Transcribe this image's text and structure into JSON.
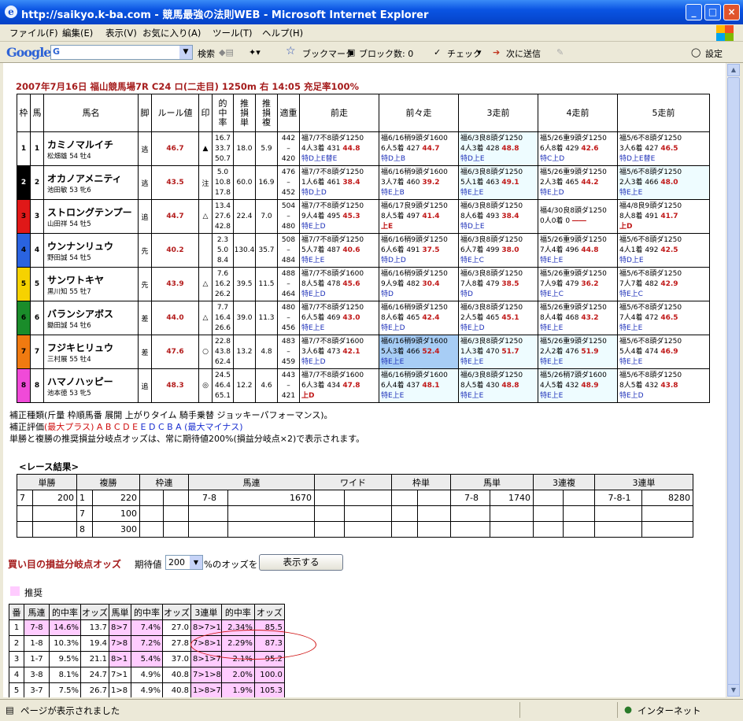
{
  "window": {
    "title": "http://saikyo.k-ba.com - 競馬最強の法則WEB - Microsoft Internet Explorer"
  },
  "menu": [
    "ファイル(F)",
    "編集(E)",
    "表示(V)",
    "お気に入り(A)",
    "ツール(T)",
    "ヘルプ(H)"
  ],
  "google_toolbar": {
    "logo": "Google",
    "search_prefix": "G",
    "search_label": "検索",
    "bookmark": "ブックマーク",
    "blocked": "ブロック数: 0",
    "check": "チェック",
    "send": "次に送信",
    "settings": "設定"
  },
  "race": {
    "title": "2007年7月16日 福山競馬場7R C24 ロ(二走目) 1250m 右 14:05 充足率100%"
  },
  "table_headers": {
    "waku": "枠",
    "uma": "馬",
    "name": "馬名",
    "kyaku": "脚",
    "rule": "ルール値",
    "shirushi": "印",
    "hit": "的中率",
    "tan": "推損単",
    "fuku": "推損複",
    "tekijyu": "適重",
    "p1": "前走",
    "p2": "前々走",
    "p3": "3走前",
    "p4": "4走前",
    "p5": "5走前"
  },
  "horses": [
    {
      "waku": "1",
      "uma": "1",
      "name": "カミノマルイチ",
      "jockey": "松畑雄 54 牡4",
      "kyaku": "逃",
      "rule": "46.7",
      "mark": "▲",
      "hit": [
        "16.7",
        "33.7",
        "50.7"
      ],
      "tan": "18.0",
      "fuku": "5.9",
      "tek": [
        "442",
        "–",
        "420"
      ],
      "past": [
        {
          "l1": "福7/7不8頭ダ1250",
          "l2a": "4人3着 431 ",
          "v": "44.8",
          "l3": "特D上E替E",
          "bg": ""
        },
        {
          "l1": "福6/16稍9頭ダ1600",
          "l2a": "6人5着 427 ",
          "v": "44.7",
          "l3": "特D上B",
          "bg": ""
        },
        {
          "l1": "福6/3良8頭ダ1250",
          "l2a": "4人3着 428 ",
          "v": "48.8",
          "l3": "特D上E",
          "bg": "cy"
        },
        {
          "l1": "福5/26重9頭ダ1250",
          "l2a": "6人8着 429 ",
          "v": "42.6",
          "l3": "特C上D",
          "bg": ""
        },
        {
          "l1": "福5/6不8頭ダ1250",
          "l2a": "3人6着 427 ",
          "v": "46.5",
          "l3": "特D上E替E",
          "bg": ""
        }
      ]
    },
    {
      "waku": "2",
      "uma": "2",
      "name": "オカノアメニティ",
      "jockey": "池田敏 53 牝6",
      "kyaku": "逃",
      "rule": "43.5",
      "mark": "注",
      "hit": [
        "5.0",
        "10.8",
        "17.8"
      ],
      "tan": "60.0",
      "fuku": "16.9",
      "tek": [
        "476",
        "–",
        "452"
      ],
      "past": [
        {
          "l1": "福7/7不8頭ダ1250",
          "l2a": "1人6着 461 ",
          "v": "38.4",
          "l3": "特D上D",
          "bg": ""
        },
        {
          "l1": "福6/16稍9頭ダ1600",
          "l2a": "3人7着 460 ",
          "v": "39.2",
          "l3": "特E上B",
          "bg": ""
        },
        {
          "l1": "福6/3良8頭ダ1250",
          "l2a": "5人1着 463 ",
          "v": "49.1",
          "l3": "特E上E",
          "bg": "cy"
        },
        {
          "l1": "福5/26重9頭ダ1250",
          "l2a": "2人3着 465 ",
          "v": "44.2",
          "l3": "特E上D",
          "bg": ""
        },
        {
          "l1": "福5/6不8頭ダ1250",
          "l2a": "2人3着 466 ",
          "v": "48.0",
          "l3": "特E上E",
          "bg": "cy"
        }
      ]
    },
    {
      "waku": "3",
      "uma": "3",
      "name": "ストロングテンプー",
      "jockey": "山田祥 54 牡5",
      "kyaku": "追",
      "rule": "44.7",
      "mark": "△",
      "hit": [
        "13.4",
        "27.6",
        "42.8"
      ],
      "tan": "22.4",
      "fuku": "7.0",
      "tek": [
        "504",
        "–",
        "480"
      ],
      "past": [
        {
          "l1": "福7/7不8頭ダ1250",
          "l2a": "9人4着 495 ",
          "v": "45.3",
          "l3": "特E上D",
          "bg": ""
        },
        {
          "l1": "福6/17良9頭ダ1250",
          "l2a": "8人5着 497 ",
          "v": "41.4",
          "l3": "上E",
          "bg": ""
        },
        {
          "l1": "福6/3良8頭ダ1250",
          "l2a": "8人6着 493 ",
          "v": "38.4",
          "l3": "特D上E",
          "bg": ""
        },
        {
          "l1": "福4/30良8頭ダ1250",
          "l2a": "0人0着 0 ",
          "v": "――",
          "l3": "",
          "bg": ""
        },
        {
          "l1": "福4/8良9頭ダ1250",
          "l2a": "8人8着 491 ",
          "v": "41.7",
          "l3": "上D",
          "bg": ""
        }
      ]
    },
    {
      "waku": "4",
      "uma": "4",
      "name": "ウンナンリュウ",
      "jockey": "野田誠 54 牡5",
      "kyaku": "先",
      "rule": "40.2",
      "mark": "",
      "hit": [
        "2.3",
        "5.0",
        "8.4"
      ],
      "tan": "130.4",
      "fuku": "35.7",
      "tek": [
        "508",
        "–",
        "484"
      ],
      "past": [
        {
          "l1": "福7/7不8頭ダ1250",
          "l2a": "5人7着 487 ",
          "v": "40.6",
          "l3": "特E上E",
          "bg": ""
        },
        {
          "l1": "福6/16稍9頭ダ1250",
          "l2a": "6人6着 491 ",
          "v": "37.5",
          "l3": "特D上D",
          "bg": ""
        },
        {
          "l1": "福6/3良8頭ダ1250",
          "l2a": "6人7着 499 ",
          "v": "38.0",
          "l3": "特E上C",
          "bg": ""
        },
        {
          "l1": "福5/26重9頭ダ1250",
          "l2a": "7人4着 496 ",
          "v": "44.8",
          "l3": "特E上E",
          "bg": ""
        },
        {
          "l1": "福5/6不8頭ダ1250",
          "l2a": "4人1着 492 ",
          "v": "42.5",
          "l3": "特D上E",
          "bg": ""
        }
      ]
    },
    {
      "waku": "5",
      "uma": "5",
      "name": "サンワトキヤ",
      "jockey": "黒川知 55 牡7",
      "kyaku": "先",
      "rule": "43.9",
      "mark": "△",
      "hit": [
        "7.6",
        "16.2",
        "26.2"
      ],
      "tan": "39.5",
      "fuku": "11.5",
      "tek": [
        "488",
        "–",
        "464"
      ],
      "past": [
        {
          "l1": "福7/7不8頭ダ1600",
          "l2a": "8人5着 478 ",
          "v": "45.6",
          "l3": "特E上D",
          "bg": ""
        },
        {
          "l1": "福6/16稍9頭ダ1250",
          "l2a": "9人9着 482 ",
          "v": "30.4",
          "l3": "特D",
          "bg": ""
        },
        {
          "l1": "福6/3良8頭ダ1250",
          "l2a": "7人8着 479 ",
          "v": "38.5",
          "l3": "特D",
          "bg": ""
        },
        {
          "l1": "福5/26重9頭ダ1250",
          "l2a": "7人9着 479 ",
          "v": "36.2",
          "l3": "特E上C",
          "bg": ""
        },
        {
          "l1": "福5/6不8頭ダ1250",
          "l2a": "7人7着 482 ",
          "v": "42.9",
          "l3": "特E上C",
          "bg": ""
        }
      ]
    },
    {
      "waku": "6",
      "uma": "6",
      "name": "バランシアボス",
      "jockey": "鋤田誠 54 牡6",
      "kyaku": "差",
      "rule": "44.0",
      "mark": "△",
      "hit": [
        "7.7",
        "16.4",
        "26.6"
      ],
      "tan": "39.0",
      "fuku": "11.3",
      "tek": [
        "480",
        "–",
        "456"
      ],
      "past": [
        {
          "l1": "福7/7不8頭ダ1250",
          "l2a": "6人5着 469 ",
          "v": "43.0",
          "l3": "特E上E",
          "bg": ""
        },
        {
          "l1": "福6/16稍9頭ダ1250",
          "l2a": "8人6着 465 ",
          "v": "42.4",
          "l3": "特E上D",
          "bg": ""
        },
        {
          "l1": "福6/3良8頭ダ1250",
          "l2a": "2人5着 465 ",
          "v": "45.1",
          "l3": "特E上D",
          "bg": ""
        },
        {
          "l1": "福5/26重9頭ダ1250",
          "l2a": "8人4着 468 ",
          "v": "43.2",
          "l3": "特E上E",
          "bg": ""
        },
        {
          "l1": "福5/6不8頭ダ1250",
          "l2a": "7人4着 472 ",
          "v": "46.5",
          "l3": "特E上E",
          "bg": ""
        }
      ]
    },
    {
      "waku": "7",
      "uma": "7",
      "name": "フジキヒリュウ",
      "jockey": "三村展 55 牡4",
      "kyaku": "差",
      "rule": "47.6",
      "mark": "○",
      "hit": [
        "22.8",
        "43.8",
        "62.4"
      ],
      "tan": "13.2",
      "fuku": "4.8",
      "tek": [
        "483",
        "–",
        "459"
      ],
      "past": [
        {
          "l1": "福7/7不8頭ダ1600",
          "l2a": "3人6着 473 ",
          "v": "42.1",
          "l3": "特E上D",
          "bg": ""
        },
        {
          "l1": "福6/16稍9頭ダ1600",
          "l2a": "5人3着 466 ",
          "v": "52.4",
          "l3": "特E上E",
          "bg": "bl"
        },
        {
          "l1": "福6/3良8頭ダ1250",
          "l2a": "1人3着 470 ",
          "v": "51.7",
          "l3": "特E上E",
          "bg": "cy"
        },
        {
          "l1": "福5/26重9頭ダ1250",
          "l2a": "2人2着 476 ",
          "v": "51.9",
          "l3": "特E上E",
          "bg": "cy"
        },
        {
          "l1": "福5/6不8頭ダ1250",
          "l2a": "5人4着 474 ",
          "v": "46.9",
          "l3": "特E上E",
          "bg": ""
        }
      ]
    },
    {
      "waku": "8",
      "uma": "8",
      "name": "ハマノハッピー",
      "jockey": "池本徳 53 牝5",
      "kyaku": "追",
      "rule": "48.3",
      "mark": "◎",
      "hit": [
        "24.5",
        "46.4",
        "65.1"
      ],
      "tan": "12.2",
      "fuku": "4.6",
      "tek": [
        "443",
        "–",
        "421"
      ],
      "past": [
        {
          "l1": "福7/7不8頭ダ1600",
          "l2a": "6人3着 434 ",
          "v": "47.8",
          "l3": "上D",
          "bg": ""
        },
        {
          "l1": "福6/16稍9頭ダ1600",
          "l2a": "6人4着 437 ",
          "v": "48.1",
          "l3": "特E上E",
          "bg": "cy"
        },
        {
          "l1": "福6/3良8頭ダ1250",
          "l2a": "8人5着 430 ",
          "v": "48.8",
          "l3": "特E上E",
          "bg": "cy"
        },
        {
          "l1": "福5/26稍7頭ダ1600",
          "l2a": "4人5着 432 ",
          "v": "48.9",
          "l3": "特E上E",
          "bg": "cy"
        },
        {
          "l1": "福5/6不8頭ダ1250",
          "l2a": "8人5着 432 ",
          "v": "43.8",
          "l3": "特E上D",
          "bg": ""
        }
      ]
    }
  ],
  "notes": {
    "line1": "補正種類(斤量 枠順馬番 展開 上がりタイム 騎手乗替 ジョッキーパフォーマンス)。",
    "line2_label": "補正評価",
    "line2_plus": "(最大プラス) A B C D E",
    "line2_minus": "E D C B A (最大マイナス)",
    "line3": "単勝と複勝の推奨損益分岐点オッズは、常に期待値200%(損益分岐点×2)で表示されます。"
  },
  "result": {
    "title": "<レース結果>",
    "headers": [
      "単勝",
      "複勝",
      "枠連",
      "馬連",
      "ワイド",
      "枠単",
      "馬単",
      "3連複",
      "3連単"
    ],
    "rows": [
      [
        "7",
        "200",
        "1",
        "220",
        "",
        "",
        "7-8",
        "1670",
        "",
        "",
        "",
        "",
        "7-8",
        "1740",
        "",
        "",
        "7-8-1",
        "8280"
      ],
      [
        "",
        "",
        "7",
        "100",
        "",
        "",
        "",
        "",
        "",
        "",
        "",
        "",
        "",
        "",
        "",
        "",
        "",
        ""
      ],
      [
        "",
        "",
        "8",
        "300",
        "",
        "",
        "",
        "",
        "",
        "",
        "",
        "",
        "",
        "",
        "",
        "",
        "",
        ""
      ]
    ]
  },
  "buy": {
    "title": "買い目の損益分岐点オッズ",
    "expect_label": "期待値",
    "expect_value": "200",
    "after_label": "%のオッズを",
    "button": "表示する",
    "legend": "推奨",
    "headers": [
      "番",
      "馬連",
      "的中率",
      "オッズ",
      "馬単",
      "的中率",
      "オッズ",
      "3連単",
      "的中率",
      "オッズ"
    ],
    "rows": [
      [
        "1",
        "7-8",
        "14.6%",
        "13.7",
        "8>7",
        "7.4%",
        "27.0",
        "8>7>1",
        "2.34%",
        "85.5"
      ],
      [
        "2",
        "1-8",
        "10.3%",
        "19.4",
        "7>8",
        "7.2%",
        "27.8",
        "7>8>1",
        "2.29%",
        "87.3"
      ],
      [
        "3",
        "1-7",
        "9.5%",
        "21.1",
        "8>1",
        "5.4%",
        "37.0",
        "8>1>7",
        "2.1%",
        "95.2"
      ],
      [
        "4",
        "3-8",
        "8.1%",
        "24.7",
        "7>1",
        "4.9%",
        "40.8",
        "7>1>8",
        "2.0%",
        "100.0"
      ],
      [
        "5",
        "3-7",
        "7.5%",
        "26.7",
        "1>8",
        "4.9%",
        "40.8",
        "1>8>7",
        "1.9%",
        "105.3"
      ]
    ]
  },
  "status": {
    "text": "ページが表示されました",
    "zone": "インターネット"
  },
  "colors": {
    "waku1": "#ffffff",
    "waku2": "#000000",
    "waku3": "#e01818",
    "waku4": "#2a63e0",
    "waku5": "#f6d200",
    "waku6": "#1a8c2a",
    "waku7": "#f07a10",
    "waku8": "#f04ad8",
    "title_red": "#a51c1c",
    "pink": "#ffccff"
  }
}
